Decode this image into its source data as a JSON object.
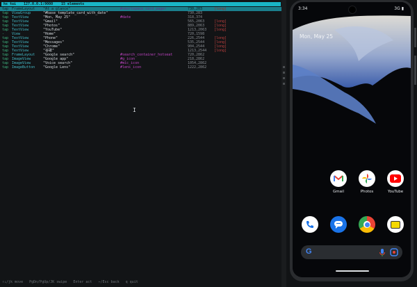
{
  "terminal": {
    "header_app": "hs tui",
    "header_device": "127.0.0.1:9000",
    "header_count": "15 elements",
    "rows": [
      {
        "action": "tap",
        "type": "FrameLayout",
        "text": "\"At a glance\"",
        "id": "#smartspace_card_pager",
        "coord": "730,203",
        "tag": "[long]"
      },
      {
        "action": "tap",
        "type": "ViewGroup",
        "text": "\"#base_template_card_with_date\"",
        "id": "",
        "coord": "730,283",
        "tag": ""
      },
      {
        "action": "tap",
        "type": "TextView",
        "text": "\"Mon, May 25\"",
        "id": "#date",
        "coord": "318,374",
        "tag": ""
      },
      {
        "action": "tap",
        "type": "TextView",
        "text": "\"Gmail\"",
        "id": "",
        "coord": "565,2063",
        "tag": "[long]"
      },
      {
        "action": "tap",
        "type": "TextView",
        "text": "\"Photos\"",
        "id": "",
        "coord": "889,2063",
        "tag": "[long]"
      },
      {
        "action": "tap",
        "type": "TextView",
        "text": "\"YouTube\"",
        "id": "",
        "coord": "1213,2063",
        "tag": "[long]"
      },
      {
        "action": "-",
        "type": "View",
        "text": "\"Home\"",
        "id": "",
        "coord": "720,1598",
        "tag": ""
      },
      {
        "action": "tap",
        "type": "TextView",
        "text": "\"Phone\"",
        "id": "",
        "coord": "226,2544",
        "tag": "[long]"
      },
      {
        "action": "tap",
        "type": "TextView",
        "text": "\"Messages\"",
        "id": "",
        "coord": "535,2544",
        "tag": "[long]"
      },
      {
        "action": "tap",
        "type": "TextView",
        "text": "\"Chrome\"",
        "id": "",
        "coord": "904,2544",
        "tag": "[long]"
      },
      {
        "action": "tap",
        "type": "TextView",
        "text": "\"谷歌\"",
        "id": "",
        "coord": "1213,2544",
        "tag": "[long]"
      },
      {
        "action": "tap",
        "type": "FrameLayout",
        "text": "\"Google search\"",
        "id": "#search_container_hotseat",
        "coord": "720,2862",
        "tag": ""
      },
      {
        "action": "tap",
        "type": "ImageView",
        "text": "\"Google app\"",
        "id": "#g_icon",
        "coord": "218,2862",
        "tag": ""
      },
      {
        "action": "tap",
        "type": "ImageView",
        "text": "\"Voice search\"",
        "id": "#mic_icon",
        "coord": "1054,2862",
        "tag": ""
      },
      {
        "action": "tap",
        "type": "ImageButton",
        "text": "\"Google Lens\"",
        "id": "#lens_icon",
        "coord": "1222,2862",
        "tag": ""
      }
    ],
    "footer": "↑↓/jk move   PgDn/PgUp/JK swipe   Enter act   ←/Esc back   q quit"
  },
  "phone": {
    "time": "3:34",
    "network": "3G",
    "date": "Mon, May 25",
    "apps_row1": [
      {
        "name": "Gmail",
        "icon": "gmail-icon"
      },
      {
        "name": "Photos",
        "icon": "photos-icon"
      },
      {
        "name": "YouTube",
        "icon": "youtube-icon"
      }
    ],
    "dock": [
      {
        "icon": "phone-icon"
      },
      {
        "icon": "messages-icon"
      },
      {
        "icon": "chrome-icon"
      },
      {
        "icon": "app-icon"
      }
    ],
    "colors": {
      "accent": "#19b5c6",
      "wallpaper_blue": "#4f6fb5"
    }
  }
}
